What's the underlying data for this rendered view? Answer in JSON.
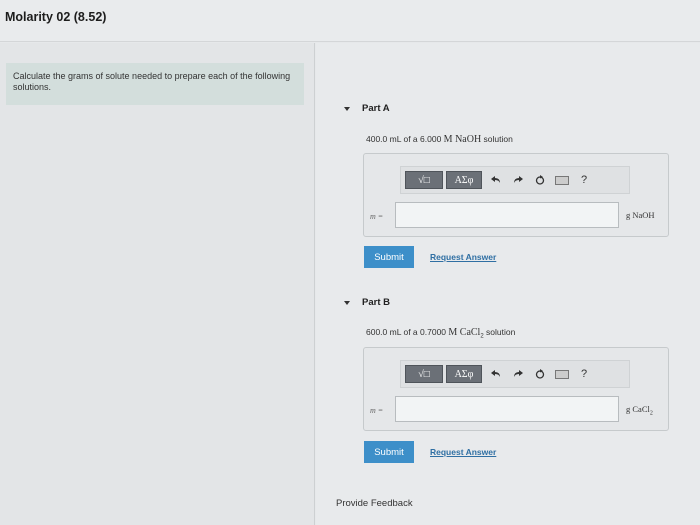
{
  "page": {
    "title": "Molarity 02 (8.52)"
  },
  "intro": {
    "text": "Calculate the grams of solute needed to prepare each of the following solutions."
  },
  "toolbar": {
    "template_label": "√□",
    "greek_label": "ΑΣφ",
    "undo_icon": "undo-arrow",
    "redo_icon": "redo-arrow",
    "reset_icon": "reset-circle",
    "keyboard_icon": "keyboard",
    "help_label": "?"
  },
  "parts": [
    {
      "heading": "Part A",
      "question_prefix": "400.0 mL of a 6.000 ",
      "question_formula": "M NaOH",
      "question_suffix": " solution",
      "var_label": "m =",
      "input_value": "",
      "unit": "g NaOH",
      "submit_label": "Submit",
      "request_label": "Request Answer"
    },
    {
      "heading": "Part B",
      "question_prefix": "600.0 mL of a 0.7000 ",
      "question_formula": "M CaCl",
      "question_sub": "2",
      "question_suffix": " solution",
      "var_label": "m =",
      "input_value": "",
      "unit": "g CaCl",
      "unit_sub": "2",
      "submit_label": "Submit",
      "request_label": "Request Answer"
    }
  ],
  "footer": {
    "feedback_label": "Provide Feedback"
  },
  "colors": {
    "submit": "#3d8fc9",
    "link": "#2f6fa3",
    "intro_bg": "#d3dedc"
  }
}
